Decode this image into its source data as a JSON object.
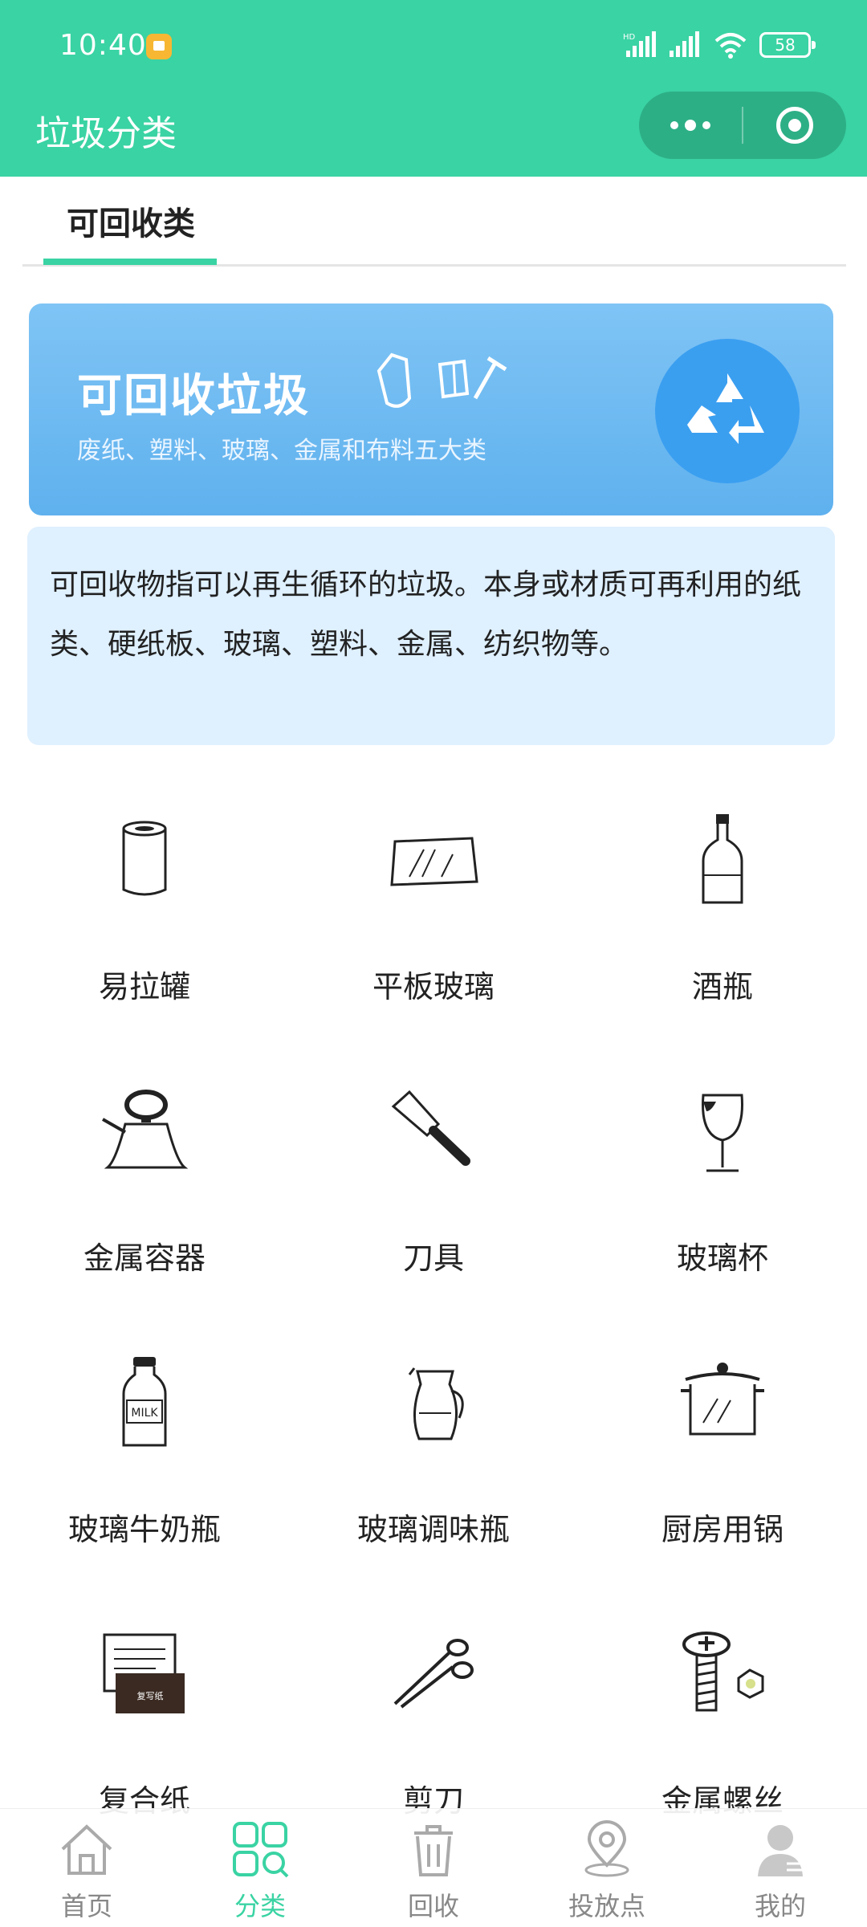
{
  "status_bar": {
    "time": "10:40",
    "network_label": "HD",
    "battery": "58"
  },
  "nav_bar": {
    "title": "垃圾分类"
  },
  "tabs": [
    {
      "label": "可回收类",
      "active": true
    }
  ],
  "banner": {
    "title": "可回收垃圾",
    "subtitle": "废纸、塑料、玻璃、金属和布料五大类",
    "background_color": "#6bb9f1",
    "icon": "recycle-icon"
  },
  "description": {
    "text": "可回收物指可以再生循环的垃圾。本身或材质可再利用的纸类、硬纸板、玻璃、塑料、金属、纺织物等。"
  },
  "items": [
    {
      "label": "易拉罐",
      "icon": "can-icon"
    },
    {
      "label": "平板玻璃",
      "icon": "glass-pane-icon"
    },
    {
      "label": "酒瓶",
      "icon": "wine-bottle-icon"
    },
    {
      "label": "金属容器",
      "icon": "kettle-icon"
    },
    {
      "label": "刀具",
      "icon": "knife-icon"
    },
    {
      "label": "玻璃杯",
      "icon": "wine-glass-icon"
    },
    {
      "label": "玻璃牛奶瓶",
      "icon": "milk-bottle-icon",
      "icon_text": "MILK"
    },
    {
      "label": "玻璃调味瓶",
      "icon": "jug-icon"
    },
    {
      "label": "厨房用锅",
      "icon": "pot-icon"
    },
    {
      "label": "复合纸",
      "icon": "paper-icon",
      "icon_text": "复写纸"
    },
    {
      "label": "剪刀",
      "icon": "scissors-icon"
    },
    {
      "label": "金属螺丝",
      "icon": "screw-icon"
    }
  ],
  "bottom_nav": [
    {
      "label": "首页",
      "icon": "home-icon",
      "active": false
    },
    {
      "label": "分类",
      "icon": "category-icon",
      "active": true
    },
    {
      "label": "回收",
      "icon": "trash-icon",
      "active": false
    },
    {
      "label": "投放点",
      "icon": "location-icon",
      "active": false
    },
    {
      "label": "我的",
      "icon": "user-icon",
      "active": false
    }
  ],
  "colors": {
    "primary": "#3ad3a3",
    "capsule": "#2daf86",
    "description_bg": "#dff0ff",
    "inactive_text": "#888888"
  }
}
